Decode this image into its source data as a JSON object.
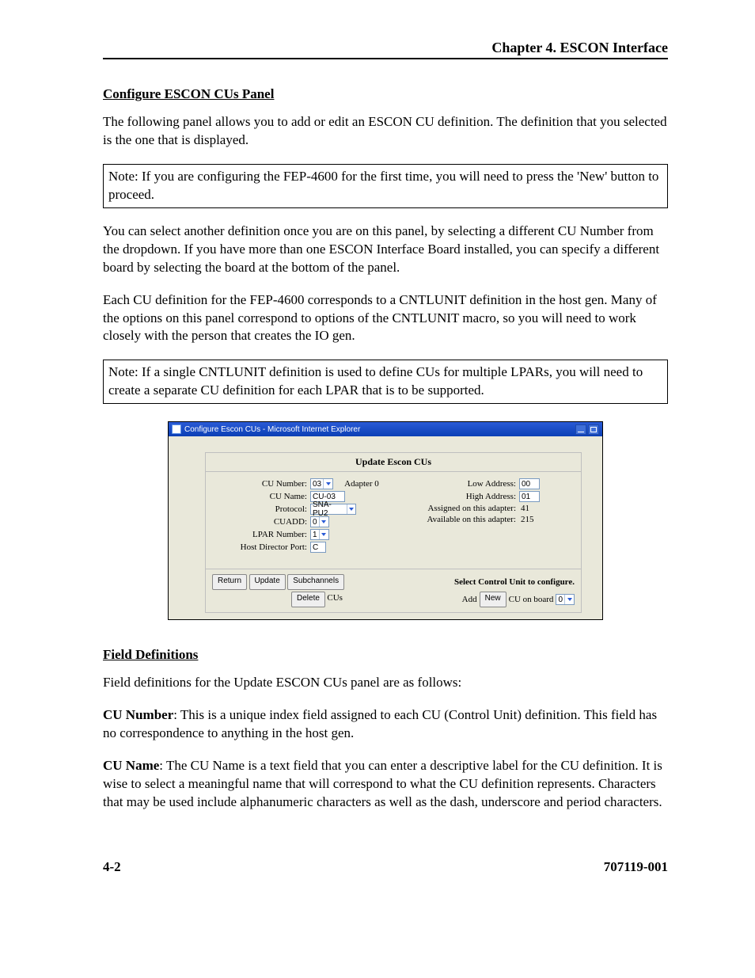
{
  "header": {
    "chapter": "Chapter 4. ESCON Interface"
  },
  "section1": {
    "title": "Configure ESCON CUs Panel",
    "para1": "The following panel allows you to add or edit an ESCON CU definition. The definition that you selected is the one that is displayed.",
    "note1": "Note: If you are configuring the FEP-4600 for the first time, you will need to press the 'New' button to proceed.",
    "para2": "You can select another definition once you are on this panel, by selecting a different CU Number from the dropdown. If you have more than one ESCON Interface Board installed, you can specify a different board by selecting the board at the bottom of the panel.",
    "para3": "Each CU definition for the FEP-4600 corresponds to a CNTLUNIT definition in the host gen. Many of the options on this panel correspond to options of the CNTLUNIT macro, so you will need to work closely with the person that creates the IO gen.",
    "note2": "Note: If a single CNTLUNIT definition is used to define CUs for multiple LPARs, you will need to create a separate CU definition for each LPAR that is to be supported."
  },
  "panel": {
    "window_title": "Configure Escon CUs - Microsoft Internet Explorer",
    "form_heading": "Update Escon CUs",
    "left": {
      "cu_number_label": "CU Number:",
      "cu_number_value": "03",
      "adapter_label": "Adapter 0",
      "cu_name_label": "CU Name:",
      "cu_name_value": "CU-03",
      "protocol_label": "Protocol:",
      "protocol_value": "SNA-PU2",
      "cuadd_label": "CUADD:",
      "cuadd_value": "0",
      "lpar_label": "LPAR Number:",
      "lpar_value": "1",
      "hdp_label": "Host Director Port:",
      "hdp_value": "C"
    },
    "right": {
      "low_label": "Low Address:",
      "low_value": "00",
      "high_label": "High Address:",
      "high_value": "01",
      "assigned_label": "Assigned on this adapter:",
      "assigned_value": "41",
      "available_label": "Available on this adapter:",
      "available_value": "215"
    },
    "buttons": {
      "return": "Return",
      "update": "Update",
      "subchannels": "Subchannels",
      "select_label": "Select Control Unit to configure.",
      "delete": "Delete",
      "delete_suffix": "CUs",
      "add_prefix": "Add",
      "new": "New",
      "add_suffix": "CU on board",
      "board_value": "0"
    }
  },
  "section2": {
    "title": "Field Definitions",
    "intro": "Field definitions for the Update ESCON CUs panel are as follows:",
    "cu_number_head": "CU Number",
    "cu_number_text": ":  This is a unique index field assigned to each CU (Control Unit) definition. This field has no correspondence to anything in the host gen.",
    "cu_name_head": "CU Name",
    "cu_name_text": ":  The CU Name is a text field that you can enter a descriptive label for the CU definition. It is wise to select a meaningful name that will correspond to what the CU definition represents. Characters that may be used include alphanumeric characters as well as the dash, underscore and period characters."
  },
  "footer": {
    "page": "4-2",
    "docnum": "707119-001"
  }
}
